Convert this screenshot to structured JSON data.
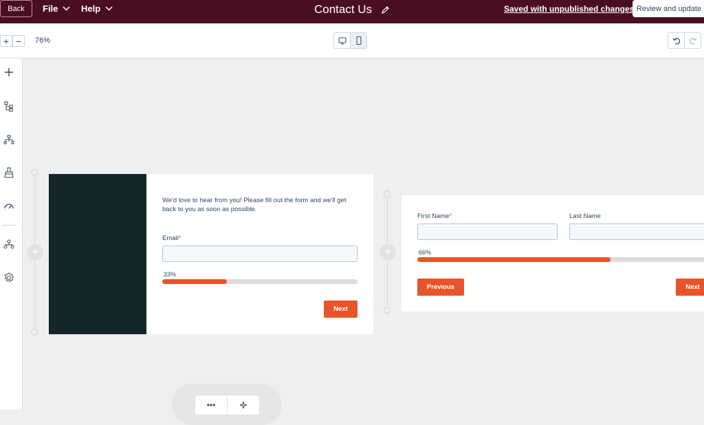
{
  "header": {
    "back_label": "Back",
    "menu_file": "File",
    "menu_help": "Help",
    "title": "Contact Us",
    "save_status": "Saved with unpublished changes",
    "review_label": "Review and update"
  },
  "toolbar": {
    "zoom_in": "+",
    "zoom_out": "−",
    "zoom_level": "76%"
  },
  "sidebar": {
    "items": [
      "add-icon",
      "layers-icon",
      "structure-icon",
      "brush-icon",
      "performance-icon",
      "hierarchy-icon",
      "settings-icon"
    ]
  },
  "step1": {
    "intro": "We'd love to hear from you! Please fill out the form and we'll get back to you as soon as possible.",
    "email_label": "Email",
    "required_mark": "*",
    "progress_label": "33%",
    "progress": 0.33,
    "next_label": "Next"
  },
  "step2": {
    "first_name_label": "First Name",
    "required_mark": "*",
    "last_name_label": "Last Name",
    "progress_label": "66%",
    "progress": 0.66,
    "previous_label": "Previous",
    "next_label": "Next"
  },
  "float_bar": {
    "more_label": "•••"
  },
  "colors": {
    "header_bg": "#4a0e24",
    "accent": "#e8542a",
    "dark_panel": "#13262a"
  }
}
